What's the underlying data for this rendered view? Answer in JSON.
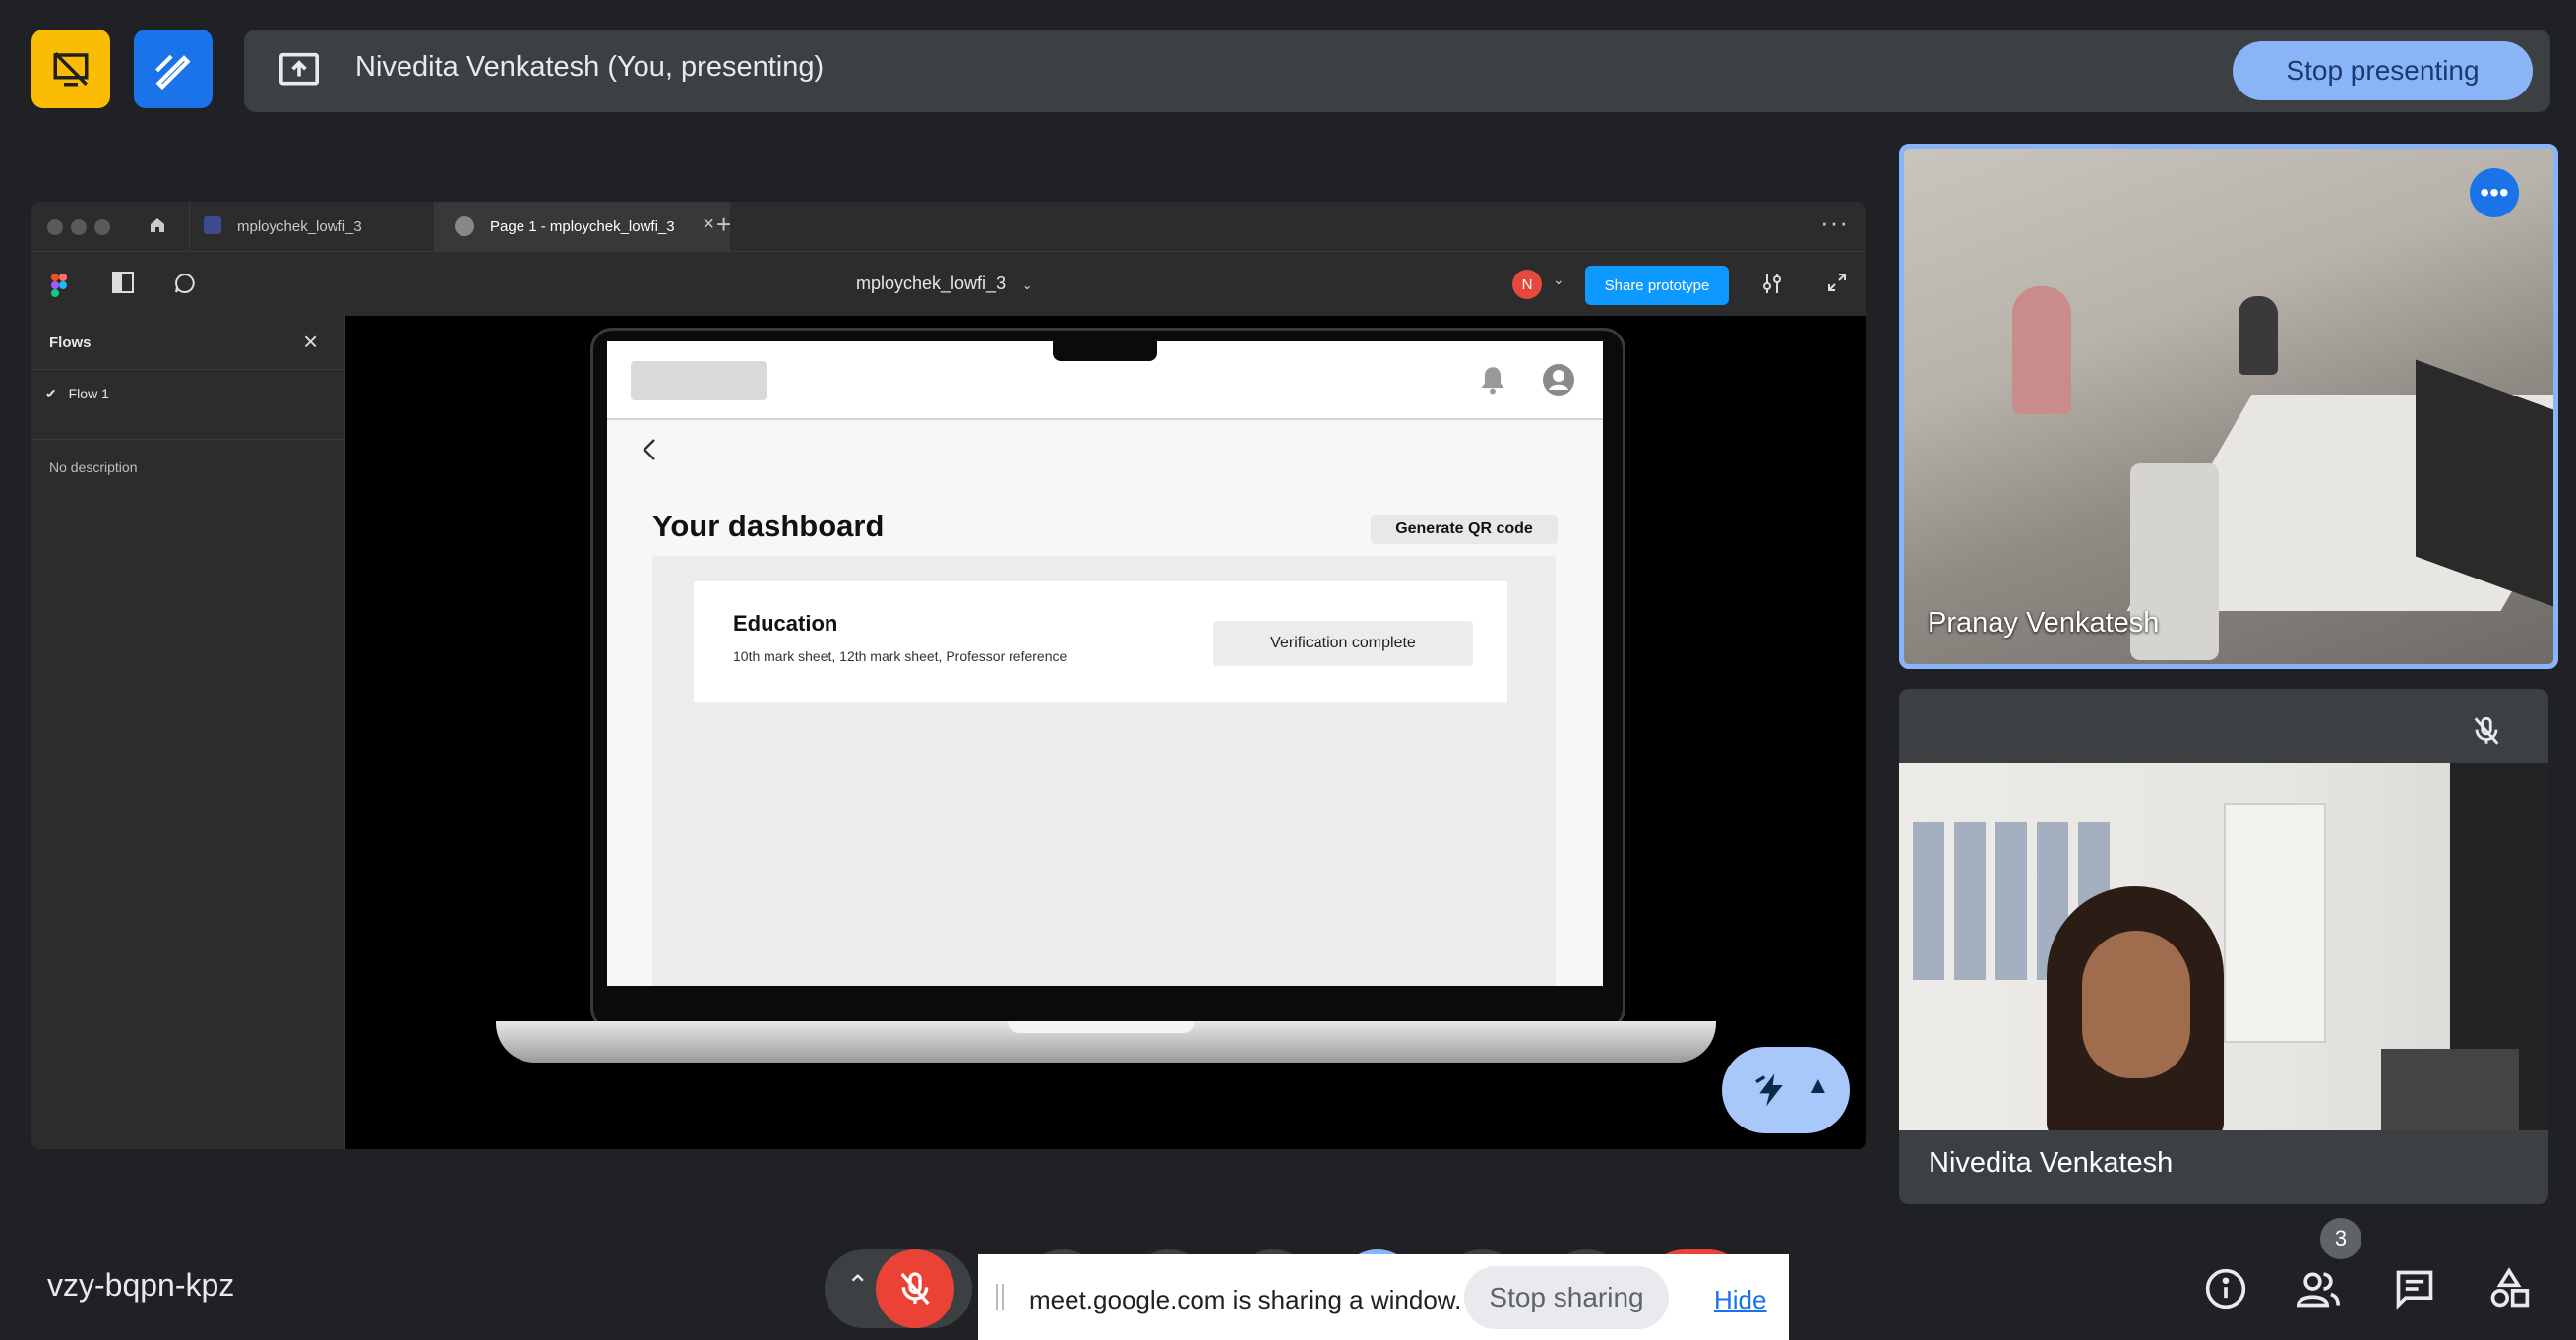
{
  "topbar": {
    "presenter_text": "Nivedita Venkatesh (You, presenting)",
    "stop_presenting_label": "Stop presenting",
    "colors": {
      "tile_yellow": "#fbbc04",
      "tile_blue": "#1a73e8",
      "accent": "#8ab4f8"
    }
  },
  "figma": {
    "tabs": [
      {
        "label": "mploychek_lowfi_3"
      },
      {
        "label": "Page 1 - mploychek_lowfi_3"
      }
    ],
    "file_title": "mploychek_lowfi_3",
    "avatar_initial": "N",
    "share_label": "Share prototype",
    "sidebar": {
      "title": "Flows",
      "flow_item": "Flow 1",
      "description": "No description"
    },
    "prototype": {
      "heading": "Your dashboard",
      "qr_button": "Generate QR code",
      "card_title": "Education",
      "card_subtitle": "10th mark sheet, 12th mark sheet, Professor reference",
      "status_button": "Verification complete"
    }
  },
  "participants": [
    {
      "name": "Pranay Venkatesh"
    },
    {
      "name": "Nivedita Venkatesh"
    }
  ],
  "bottombar": {
    "meeting_code": "vzy-bqpn-kpz",
    "people_count": "3",
    "share_notice": "meet.google.com is sharing a window.",
    "stop_sharing_label": "Stop sharing",
    "hide_label": "Hide"
  }
}
